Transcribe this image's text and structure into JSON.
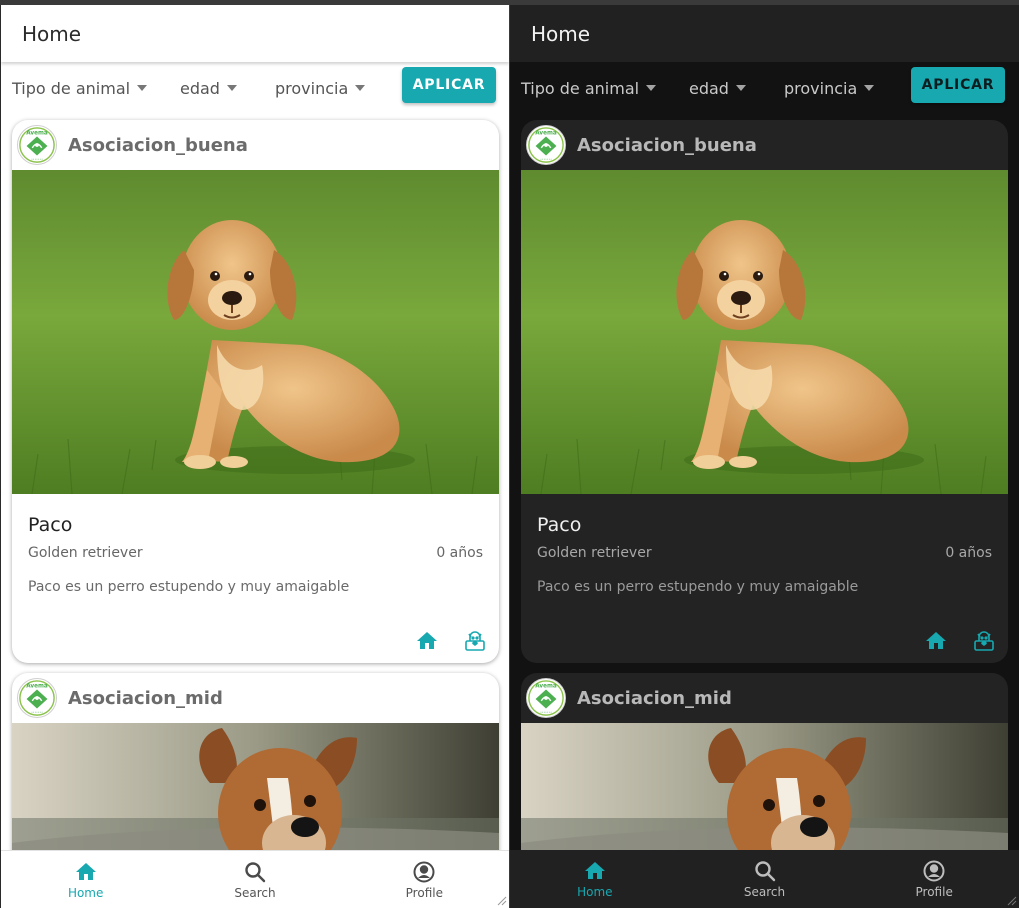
{
  "appbar": {
    "title": "Home"
  },
  "filters": {
    "animal_type": "Tipo de animal",
    "age": "edad",
    "province": "provincia",
    "apply_label": "APLICAR"
  },
  "cards": [
    {
      "org_name": "Asociacion_buena",
      "pet_name": "Paco",
      "breed": "Golden retriever",
      "age": "0 años",
      "description": "Paco es un perro estupendo y muy amaigable",
      "photo": "golden-retriever-puppy-on-grass"
    },
    {
      "org_name": "Asociacion_mid",
      "photo": "smiling-brown-dog"
    }
  ],
  "logo_text": "Avema",
  "nav": {
    "home": "Home",
    "search": "Search",
    "profile": "Profile"
  },
  "colors": {
    "accent": "#17a8b0",
    "dark_bg": "#121212",
    "dark_surface": "#232323",
    "light_surface": "#ffffff"
  }
}
